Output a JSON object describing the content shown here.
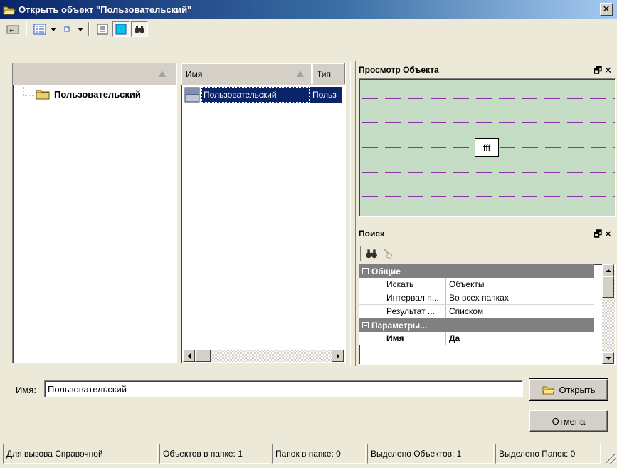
{
  "window": {
    "title": "Открыть объект \"Пользовательский\"",
    "close": "✕"
  },
  "tree": {
    "root_label": "Пользовательский"
  },
  "list": {
    "columns": [
      "Имя",
      "Тип"
    ],
    "rows": [
      {
        "name": "Пользовательский",
        "type": "Польз"
      }
    ]
  },
  "preview": {
    "title": "Просмотр Объекта",
    "object_label": "fff"
  },
  "search": {
    "title": "Поиск",
    "categories": [
      {
        "label": "Общие",
        "rows": [
          {
            "name": "Искать",
            "value": "Объекты"
          },
          {
            "name": "Интервал п...",
            "value": "Во всех папках"
          },
          {
            "name": "Результат ...",
            "value": "Списком"
          }
        ]
      },
      {
        "label": "Параметры...",
        "rows": [
          {
            "name": "Имя",
            "value": "Да"
          }
        ]
      }
    ]
  },
  "footer": {
    "name_label": "Имя:",
    "name_value": "Пользовательский",
    "open_button": "Открыть",
    "cancel_button": "Отмена"
  },
  "statusbar": [
    "Для вызова Справочной",
    "Объектов в папке: 1",
    "Папок в папке: 0",
    "Выделено Объектов: 1",
    "Выделено Папок: 0"
  ],
  "colors": {
    "preview_bg": "#c4dcc4",
    "dash_line": "#8b2fa8",
    "selection": "#0a246a",
    "title_start": "#0a246a"
  },
  "icons": [
    "up-folder-icon",
    "details-view-icon",
    "small-icons-view-icon",
    "list-pane-icon",
    "preview-pane-icon",
    "search-binoculars-icon",
    "folder-icon",
    "open-folder-icon",
    "clear-brush-icon",
    "restore-pane-icon"
  ]
}
